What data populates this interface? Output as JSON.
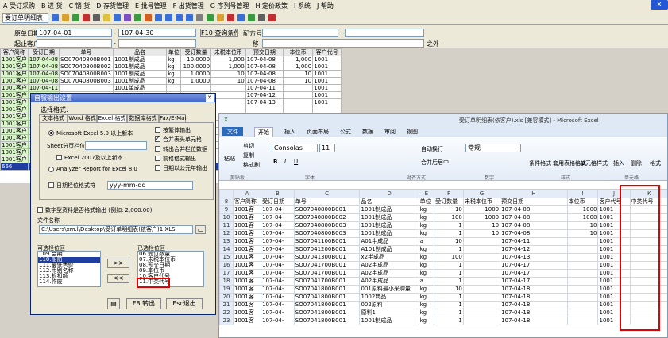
{
  "menu": [
    "A 受订采购",
    "B 进 货",
    "C 销 货",
    "D 存货管理",
    "E 批号管理",
    "F 出货管理",
    "G 序列号管理",
    "H 定价政策",
    "I 系统",
    "J 帮助"
  ],
  "toolbar": {
    "report_select": "受订单明细表"
  },
  "filter": {
    "date_label": "原单日期",
    "date_from": "107-04-01",
    "date_to": "107-04-30",
    "query_button": "F10 查询条件",
    "doc_label": "配方号",
    "start_label": "起止客户",
    "end_suffix": "之外",
    "dash": "-",
    "tilde": "~",
    "seq_label": "移"
  },
  "grid": {
    "headers": [
      "客户简称",
      "受订日期",
      "单号",
      "品名",
      "单位",
      "受订数量",
      "未税本位币",
      "预交日期",
      "本位币",
      "客户代号"
    ],
    "rows": [
      [
        "1001客户",
        "107-04-08",
        "SO07040800B001",
        "1001制成品",
        "kg",
        "10.0000",
        "1,000",
        "107-04-08",
        "1,000",
        "1001"
      ],
      [
        "1001客户",
        "107-04-08",
        "SO07040800B002",
        "1001制成品",
        "kg",
        "100.0000",
        "1,000",
        "107-04-08",
        "1,000",
        "1001"
      ],
      [
        "1001客户",
        "107-04-08",
        "SO07040800B003",
        "1001制成品",
        "kg",
        "1.0000",
        "10",
        "107-04-08",
        "10",
        "1001"
      ],
      [
        "1001客户",
        "107-04-08",
        "SO07040800B003",
        "1001制成品",
        "kg",
        "1.0000",
        "10",
        "107-04-08",
        "10",
        "1001"
      ],
      [
        "1001客户",
        "107-04-11",
        "",
        "1001单成品",
        "",
        "",
        "",
        "107-04-11",
        "",
        "1001"
      ],
      [
        "1001客户",
        "",
        "",
        "",
        "",
        "",
        "",
        "107-04-12",
        "",
        "1001"
      ],
      [
        "1001客户",
        "",
        "",
        "",
        "",
        "",
        "",
        "107-04-13",
        "",
        "1001"
      ],
      [
        "1001客户",
        "",
        "",
        "",
        "",
        "",
        "",
        "",
        "",
        ""
      ],
      [
        "1001客户",
        "",
        "",
        "",
        "",
        "",
        "",
        "",
        "",
        ""
      ],
      [
        "1001客户",
        "",
        "",
        "",
        "",
        "",
        "",
        "",
        "",
        ""
      ],
      [
        "1001客户",
        "",
        "",
        "",
        "",
        "",
        "",
        "",
        "",
        ""
      ],
      [
        "1001客户",
        "",
        "",
        "",
        "",
        "",
        "",
        "",
        "",
        ""
      ],
      [
        "1001客户",
        "",
        "",
        "",
        "",
        "",
        "",
        "",
        "",
        ""
      ],
      [
        "1001客户",
        "",
        "",
        "",
        "",
        "",
        "",
        "",
        "",
        ""
      ],
      [
        "1001客户",
        "",
        "",
        "",
        "",
        "",
        "",
        "",
        "",
        ""
      ],
      [
        "666",
        "",
        "",
        "",
        "",
        "",
        "",
        "",
        "",
        ""
      ]
    ]
  },
  "dialog": {
    "title": "自服输出设置",
    "format_label": "选择格式:",
    "tabs": [
      "文本格式",
      "Word 格式",
      "Excel 格式",
      "数据库格式",
      "Fax/E-Mail"
    ],
    "radio_excel5": "Microsoft Excel 5.0 以上新本",
    "sheet_label": "Sheet分页栏位",
    "chk_excel2007": "Excel 2007及以上新本",
    "radio_analyzer": "Analyzer Report  for Excel 8.0",
    "chk_date": "日期栏位格式符",
    "date_fmt": "yyy-mm-dd",
    "right_chks": [
      "按繁体输出",
      "合并表头单元格",
      "转出合并栏位数据",
      "前格格式输出",
      "日期以公元年输出"
    ],
    "num_chk": "数字型资料是否格式输出  (例如: 2,000.00)",
    "filename_label": "文件名称",
    "filename": "C:\\Users\\xm.l\\Desktop\\受订单明细表(依客户)1.XLS",
    "avail_label": "可选栏位区",
    "avail": [
      "109.会期",
      "110.船舶",
      "111.最低售价",
      "112.币别名称",
      "113.折扣额",
      "114.作废"
    ],
    "sel_label": "已选栏位区",
    "selected": [
      "06.受订数量",
      "07.未税本位币",
      "08.预交日期",
      "09.本位币",
      "10.客户代号",
      "11.中类代号"
    ],
    "btn_add": ">>",
    "btn_remove": "<<",
    "btn_print": "F8 转出",
    "btn_exit": "Esc退出"
  },
  "excel": {
    "title": "受订单明细表(依客户).xls [兼容模式] - Microsoft Excel",
    "tabs": [
      "文件",
      "开始",
      "插入",
      "页面布局",
      "公式",
      "数据",
      "审阅",
      "视图"
    ],
    "font": "Consolas",
    "size": "11",
    "numfmt": "常规",
    "ribbon_groups": [
      "剪贴板",
      "字体",
      "对齐方式",
      "数字",
      "样式",
      "单元格"
    ],
    "ribbon_btns": {
      "paste": "粘贴",
      "cut": "剪切",
      "copy": "复制",
      "painter": "格式刷",
      "wrap": "自动换行",
      "merge": "合并后居中",
      "cond": "条件格式",
      "table": "套用表格格式",
      "cellstyle": "单元格样式",
      "insert": "插入",
      "delete": "删除",
      "format": "格式"
    },
    "cols": [
      "",
      "A",
      "B",
      "C",
      "D",
      "E",
      "F",
      "G",
      "H",
      "I",
      "J",
      "K"
    ],
    "rows": [
      [
        "8",
        "客户简称",
        "受订日期",
        "单号",
        "品名",
        "单位",
        "受订数量",
        "未税本位币",
        "预交日期",
        "本位币",
        "客户代号",
        "中类代号"
      ],
      [
        "9",
        "1001客",
        "107-04-",
        "SO07040800B001",
        "1001制成品",
        "kg",
        "10",
        "1000",
        "107-04-08",
        "1000",
        "1001",
        ""
      ],
      [
        "10",
        "1001客",
        "107-04-",
        "SO07040800B002",
        "1001制成品",
        "kg",
        "100",
        "1000",
        "107-04-08",
        "1000",
        "1001",
        ""
      ],
      [
        "11",
        "1001客",
        "107-04-",
        "SO07040800B003",
        "1001制成品",
        "kg",
        "1",
        "10",
        "107-04-08",
        "10",
        "1001",
        ""
      ],
      [
        "12",
        "1001客",
        "107-04-",
        "SO07040800B003",
        "1001制成品",
        "kg",
        "1",
        "10",
        "107-04-08",
        "10",
        "1001",
        ""
      ],
      [
        "13",
        "1001客",
        "107-04-",
        "SO07041100B001",
        "A01半成品",
        "a",
        "10",
        "",
        "107-04-11",
        "",
        "1001",
        ""
      ],
      [
        "14",
        "1001客",
        "107-04-",
        "SO07041200B001",
        "A101制成品",
        "kg",
        "1",
        "",
        "107-04-12",
        "",
        "1001",
        ""
      ],
      [
        "15",
        "1001客",
        "107-04-",
        "SO07041300B001",
        "x2半成品",
        "kg",
        "100",
        "",
        "107-04-13",
        "",
        "1001",
        ""
      ],
      [
        "16",
        "1001客",
        "107-04-",
        "SO07041700B001",
        "A02半成品",
        "kg",
        "1",
        "",
        "107-04-17",
        "",
        "1001",
        ""
      ],
      [
        "17",
        "1001客",
        "107-04-",
        "SO07041700B001",
        "A02半成品",
        "kg",
        "1",
        "",
        "107-04-17",
        "",
        "1001",
        ""
      ],
      [
        "18",
        "1001客",
        "107-04-",
        "SO07041700B001",
        "A02半成品",
        "a",
        "1",
        "",
        "107-04-17",
        "",
        "1001",
        ""
      ],
      [
        "19",
        "1001客",
        "107-04-",
        "SO07041800B001",
        "001原料最小采购量",
        "kg",
        "10",
        "",
        "107-04-18",
        "",
        "1001",
        ""
      ],
      [
        "20",
        "1001客",
        "107-04-",
        "SO07041800B001",
        "1002商品",
        "kg",
        "1",
        "",
        "107-04-18",
        "",
        "1001",
        ""
      ],
      [
        "21",
        "1001客",
        "107-04-",
        "SO07041800B001",
        "002原料",
        "kg",
        "1",
        "",
        "107-04-18",
        "",
        "1001",
        ""
      ],
      [
        "22",
        "1001客",
        "107-04-",
        "SO07041800B001",
        "原料1",
        "kg",
        "1",
        "",
        "107-04-18",
        "",
        "1001",
        ""
      ],
      [
        "23",
        "1001客",
        "107-04-",
        "SO07041800B001",
        "1001制成品",
        "kg",
        "1",
        "",
        "107-04-18",
        "",
        "1001",
        ""
      ]
    ]
  }
}
